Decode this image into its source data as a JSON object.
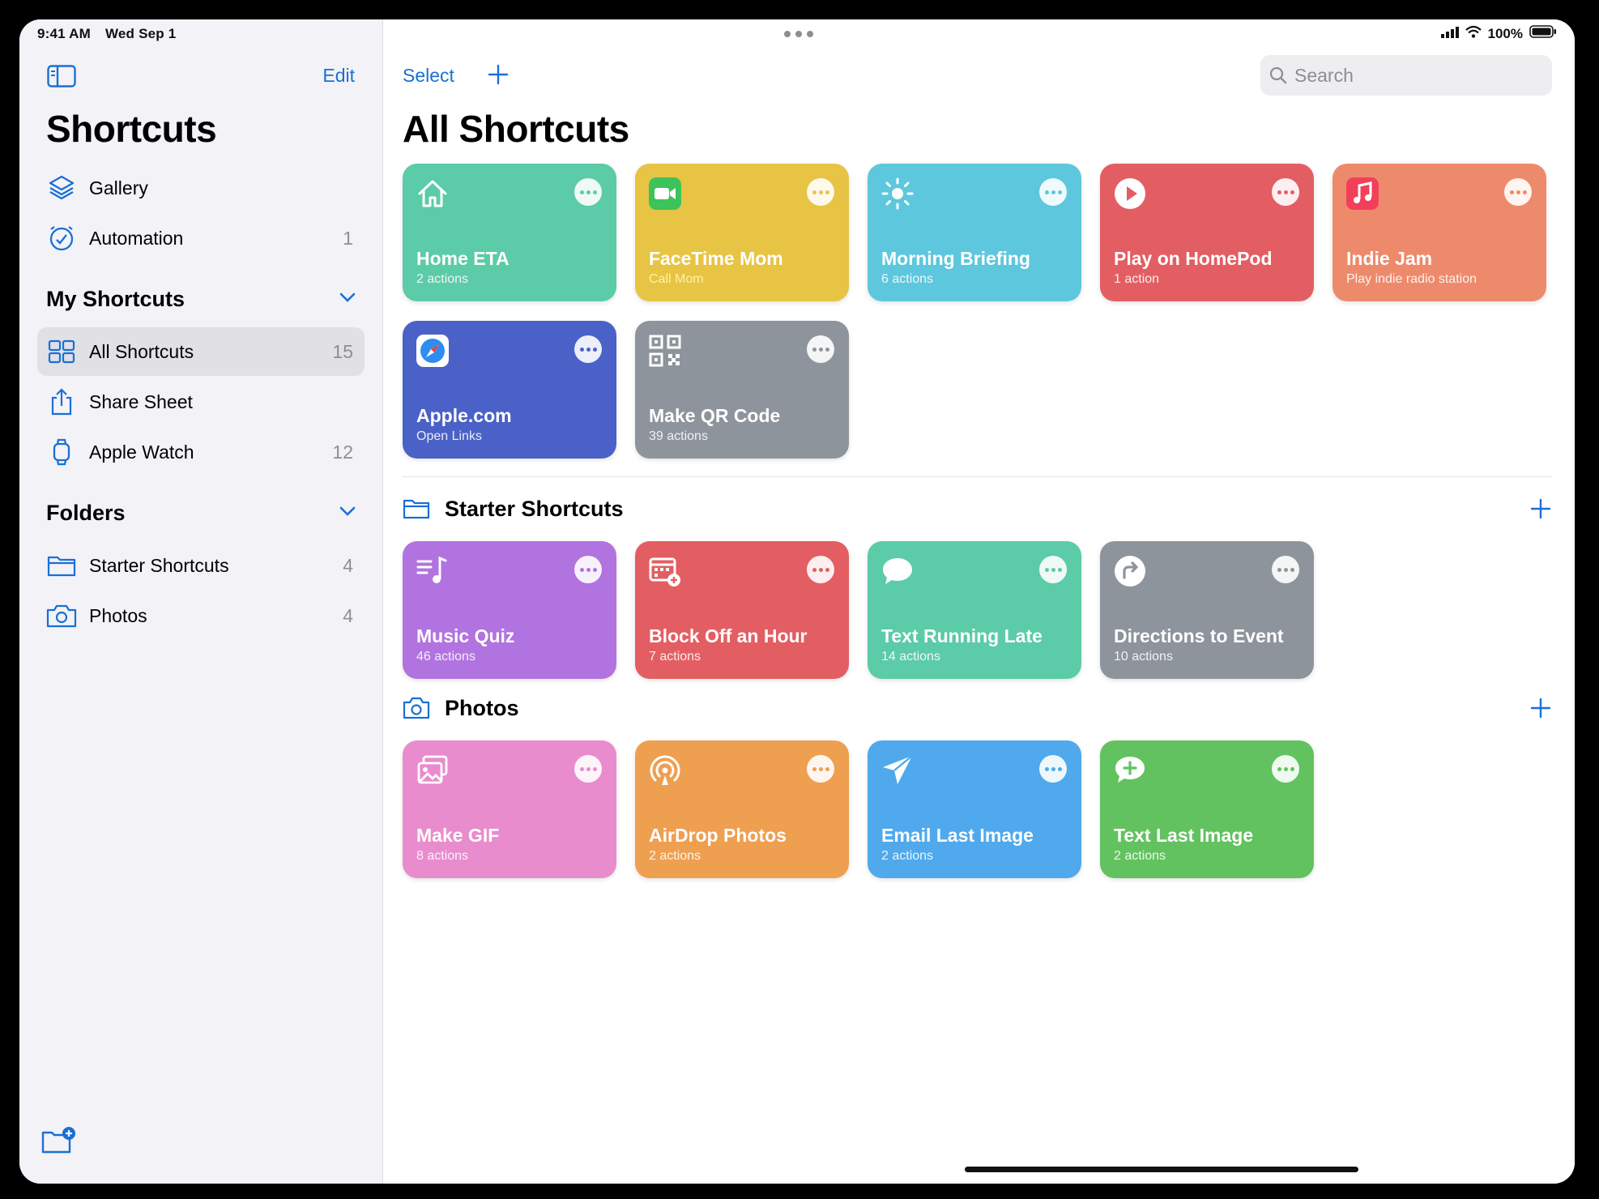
{
  "status": {
    "time": "9:41 AM",
    "date": "Wed Sep 1",
    "battery": "100%"
  },
  "sidebar": {
    "edit_label": "Edit",
    "title": "Shortcuts",
    "top_items": [
      {
        "label": "Gallery",
        "count": ""
      },
      {
        "label": "Automation",
        "count": "1"
      }
    ],
    "my_shortcuts_header": "My Shortcuts",
    "my_items": [
      {
        "label": "All Shortcuts",
        "count": "15"
      },
      {
        "label": "Share Sheet",
        "count": ""
      },
      {
        "label": "Apple Watch",
        "count": "12"
      }
    ],
    "folders_header": "Folders",
    "folder_items": [
      {
        "label": "Starter Shortcuts",
        "count": "4"
      },
      {
        "label": "Photos",
        "count": "4"
      }
    ]
  },
  "header": {
    "select_label": "Select",
    "search_placeholder": "Search",
    "title": "All Shortcuts"
  },
  "all_shortcuts": [
    {
      "title": "Home ETA",
      "subtitle": "2 actions",
      "color": "#5ccba7",
      "icon": "house-icon"
    },
    {
      "title": "FaceTime Mom",
      "subtitle": "Call Mom",
      "color": "#e7c444",
      "icon": "facetime-icon"
    },
    {
      "title": "Morning Briefing",
      "subtitle": "6 actions",
      "color": "#5dc7dd",
      "icon": "sun-icon"
    },
    {
      "title": "Play on HomePod",
      "subtitle": "1 action",
      "color": "#e35e63",
      "icon": "play-icon"
    },
    {
      "title": "Indie Jam",
      "subtitle": "Play indie radio station",
      "color": "#ee8a6c",
      "icon": "music-icon"
    },
    {
      "title": "Apple.com",
      "subtitle": "Open Links",
      "color": "#4a61c7",
      "icon": "safari-icon"
    },
    {
      "title": "Make QR Code",
      "subtitle": "39 actions",
      "color": "#8e949c",
      "icon": "qr-code-icon"
    }
  ],
  "folders": [
    {
      "name": "Starter Shortcuts",
      "icon": "folder-icon",
      "shortcuts": [
        {
          "title": "Music Quiz",
          "subtitle": "46 actions",
          "color": "#b173df",
          "icon": "music-list-icon"
        },
        {
          "title": "Block Off an Hour",
          "subtitle": "7 actions",
          "color": "#e35e63",
          "icon": "calendar-add-icon"
        },
        {
          "title": "Text Running Late",
          "subtitle": "14 actions",
          "color": "#5ccba7",
          "icon": "speech-bubble-icon"
        },
        {
          "title": "Directions to Event",
          "subtitle": "10 actions",
          "color": "#8e949c",
          "icon": "directions-icon"
        }
      ]
    },
    {
      "name": "Photos",
      "icon": "camera-icon",
      "shortcuts": [
        {
          "title": "Make GIF",
          "subtitle": "8 actions",
          "color": "#e88ccd",
          "icon": "photos-icon"
        },
        {
          "title": "AirDrop Photos",
          "subtitle": "2 actions",
          "color": "#ee9f50",
          "icon": "airdrop-icon"
        },
        {
          "title": "Email Last Image",
          "subtitle": "2 actions",
          "color": "#4fa9ec",
          "icon": "paper-plane-icon"
        },
        {
          "title": "Text Last Image",
          "subtitle": "2 actions",
          "color": "#62c25f",
          "icon": "message-add-icon"
        }
      ]
    }
  ]
}
